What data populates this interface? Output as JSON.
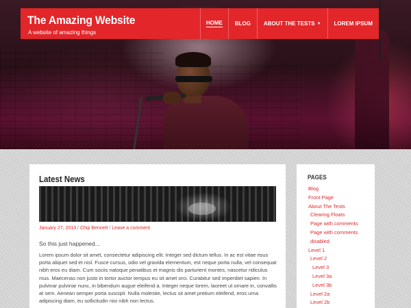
{
  "header": {
    "site_title": "The Amazing Website",
    "site_description": "A website of amazing things",
    "nav": [
      {
        "label": "Home",
        "active": true
      },
      {
        "label": "Blog",
        "active": false
      },
      {
        "label": "About The Tests",
        "active": false,
        "has_dropdown": true
      },
      {
        "label": "Lorem Ipsum",
        "active": false
      }
    ]
  },
  "main": {
    "section_title": "Latest News",
    "post": {
      "date": "January 27, 2013",
      "author": "Chip Bennett",
      "comments_link": "Leave a comment",
      "lead": "So this just happened...",
      "body": "Lorem ipsum dolor sit amet, consectetur adipiscing elit. Integer sed dictum tellus. In ac est vitae risus porta aliquet sed et nisl. Fusce cursus, odio vel gravida elementum, est neque porta nulla, vel consequat nibh eros eu diam. Cum sociis natoque penatibus et magnis dis parturient montes, nascetur ridiculus mus. Maecenas non justo in tortor auctor tempus eu sit amet orci. Curabitur sed imperdiet sapien. In pulvinar pulvinar nunc, in bibendum augue eleifend a. Integer neque lorem, laoreet ut ornare in, convallis at sem. Aenean semper porta suscipit. Nulla molestie, lectus sit amet pretium eleifend, eros urna adipiscing diam, eu sollicitudin nisi nibh non lectus."
    }
  },
  "sidebar": {
    "widget_title": "Pages",
    "pages": [
      {
        "label": "Blog",
        "level": 0
      },
      {
        "label": "Front Page",
        "level": 0
      },
      {
        "label": "About The Tests",
        "level": 0
      },
      {
        "label": "Clearing Floats",
        "level": 1
      },
      {
        "label": "Page with comments",
        "level": 1
      },
      {
        "label": "Page with comments",
        "level": 1
      },
      {
        "label": "disabled",
        "level": 1
      },
      {
        "label": "Level 1",
        "level": 0
      },
      {
        "label": "Level 2",
        "level": 1
      },
      {
        "label": "Level 3",
        "level": 2
      },
      {
        "label": "Level 3a",
        "level": 2
      },
      {
        "label": "Level 3b",
        "level": 2
      },
      {
        "label": "Level 2a",
        "level": 1
      },
      {
        "label": "Level 2b",
        "level": 1
      }
    ]
  },
  "colors": {
    "accent": "#e2262a",
    "background": "#d7d7d7",
    "text": "#444444"
  }
}
